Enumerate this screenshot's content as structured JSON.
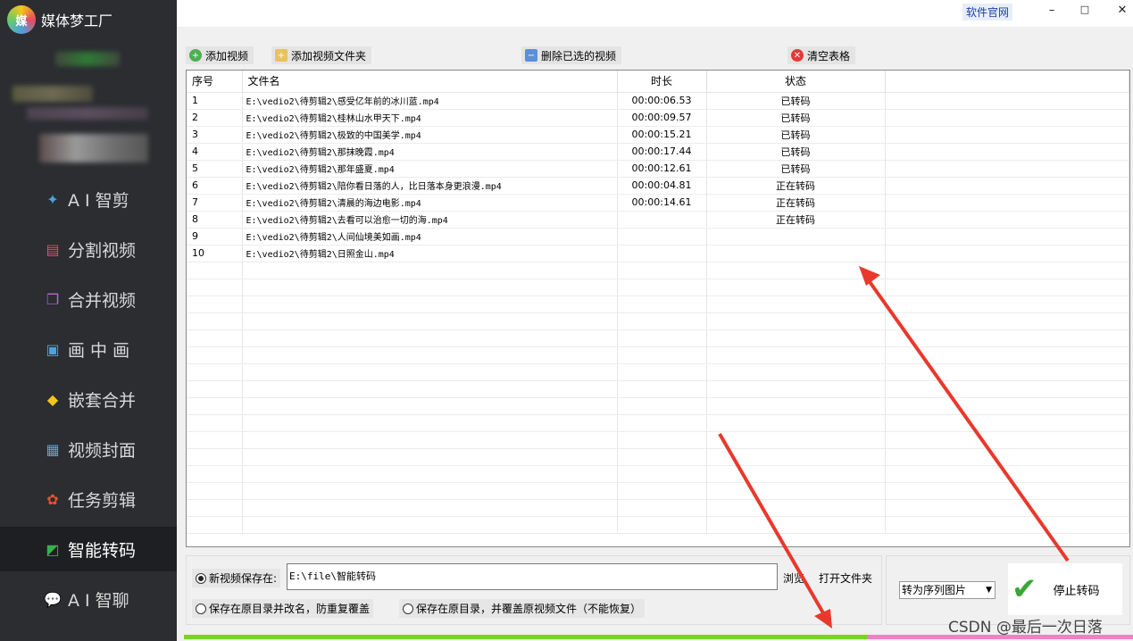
{
  "app": {
    "title": "媒体梦工厂",
    "logo_text": "媒"
  },
  "topbar": {
    "site_link": "软件官网",
    "minimize": "–",
    "maximize": "□",
    "close": "✕"
  },
  "sidebar": {
    "items": [
      {
        "label": "A I 智剪",
        "icon": "ai-clip-icon",
        "active": false
      },
      {
        "label": "分割视频",
        "icon": "split-video-icon",
        "active": false
      },
      {
        "label": "合并视频",
        "icon": "merge-video-icon",
        "active": false
      },
      {
        "label": "画 中 画",
        "icon": "picture-in-picture-icon",
        "active": false
      },
      {
        "label": "嵌套合并",
        "icon": "nested-merge-icon",
        "active": false
      },
      {
        "label": "视频封面",
        "icon": "video-cover-icon",
        "active": false
      },
      {
        "label": "任务剪辑",
        "icon": "task-edit-icon",
        "active": false
      },
      {
        "label": "智能转码",
        "icon": "smart-transcode-icon",
        "active": true
      },
      {
        "label": "A I 智聊",
        "icon": "ai-chat-icon",
        "active": false
      }
    ]
  },
  "toolbar": {
    "add_video": "添加视频",
    "add_folder": "添加视频文件夹",
    "delete_selected": "删除已选的视频",
    "clear_table": "清空表格"
  },
  "table": {
    "headers": [
      "序号",
      "文件名",
      "时长",
      "状态"
    ],
    "rows": [
      [
        "1",
        "E:\\vedio2\\待剪辑2\\感受亿年前的冰川蓝.mp4",
        "00:00:06.53",
        "已转码"
      ],
      [
        "2",
        "E:\\vedio2\\待剪辑2\\桂林山水甲天下.mp4",
        "00:00:09.57",
        "已转码"
      ],
      [
        "3",
        "E:\\vedio2\\待剪辑2\\极致的中国美学.mp4",
        "00:00:15.21",
        "已转码"
      ],
      [
        "4",
        "E:\\vedio2\\待剪辑2\\那抹晚霞.mp4",
        "00:00:17.44",
        "已转码"
      ],
      [
        "5",
        "E:\\vedio2\\待剪辑2\\那年盛夏.mp4",
        "00:00:12.61",
        "已转码"
      ],
      [
        "6",
        "E:\\vedio2\\待剪辑2\\陪你看日落的人，比日落本身更浪漫.mp4",
        "00:00:04.81",
        "正在转码"
      ],
      [
        "7",
        "E:\\vedio2\\待剪辑2\\清晨的海边电影.mp4",
        "00:00:14.61",
        "正在转码"
      ],
      [
        "8",
        "E:\\vedio2\\待剪辑2\\去看可以治愈一切的海.mp4",
        "",
        "正在转码"
      ],
      [
        "9",
        "E:\\vedio2\\待剪辑2\\人间仙境美如画.mp4",
        "",
        ""
      ],
      [
        "10",
        "E:\\vedio2\\待剪辑2\\日照金山.mp4",
        "",
        ""
      ]
    ]
  },
  "output": {
    "save_new_label": "新视频保存在:",
    "save_path": "E:\\file\\智能转码",
    "browse": "浏览",
    "open_folder": "打开文件夹",
    "save_rename": "保存在原目录并改名，防重复覆盖",
    "save_overwrite": "保存在原目录，并覆盖原视频文件（不能恢复）"
  },
  "convert": {
    "format_selected": "转为序列图片",
    "stop_button": "停止转码"
  },
  "progress": {
    "value_percent": 72
  },
  "watermark": "CSDN @最后一次日落",
  "colors": {
    "sidebar_bg": "#2b2d31",
    "progress_done": "#7bd321",
    "progress_rest": "#ee82c7",
    "arrow": "#e8392c"
  }
}
